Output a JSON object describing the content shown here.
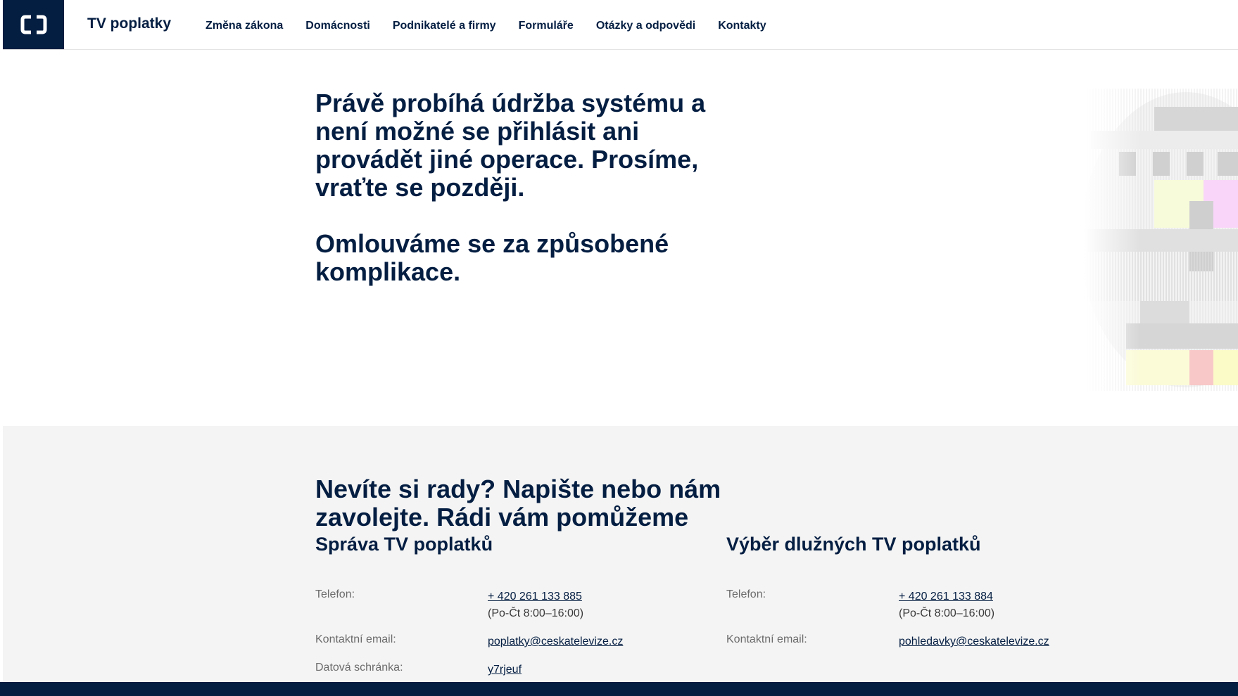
{
  "header": {
    "site_title": "TV poplatky",
    "nav": [
      "Změna zákona",
      "Domácnosti",
      "Podnikatelé a firmy",
      "Formuláře",
      "Otázky a odpovědi",
      "Kontakty"
    ]
  },
  "hero": {
    "paragraph1": "Právě probíhá údržba systému a není možné se přihlásit ani provádět jiné operace. Prosíme, vraťte se později.",
    "paragraph2": "Omlouváme se za způsobené komplikace."
  },
  "contact": {
    "title": "Nevíte si rady? Napište nebo nám zavolejte. Rádi vám pomůžeme",
    "left": {
      "title": "Správa TV poplatků",
      "phone_label": "Telefon:",
      "phone": "+ 420 261 133 885",
      "hours": "(Po-Čt 8:00–16:00)",
      "email_label": "Kontaktní email:",
      "email": "poplatky@ceskatelevize.cz",
      "databox_label": "Datová schránka:",
      "databox": "y7rjeuf"
    },
    "right": {
      "title": "Výběr dlužných TV poplatků",
      "phone_label": "Telefon:",
      "phone": "+ 420 261 133 884",
      "hours": "(Po-Čt 8:00–16:00)",
      "email_label": "Kontaktní email:",
      "email": "pohledavky@ceskatelevize.cz"
    }
  },
  "colors": {
    "brand_navy": "#041e42",
    "contact_bg": "#f4f4f4"
  },
  "icons": {
    "logo": "ct-logo-icon",
    "pattern": "tv-test-pattern-icon"
  }
}
